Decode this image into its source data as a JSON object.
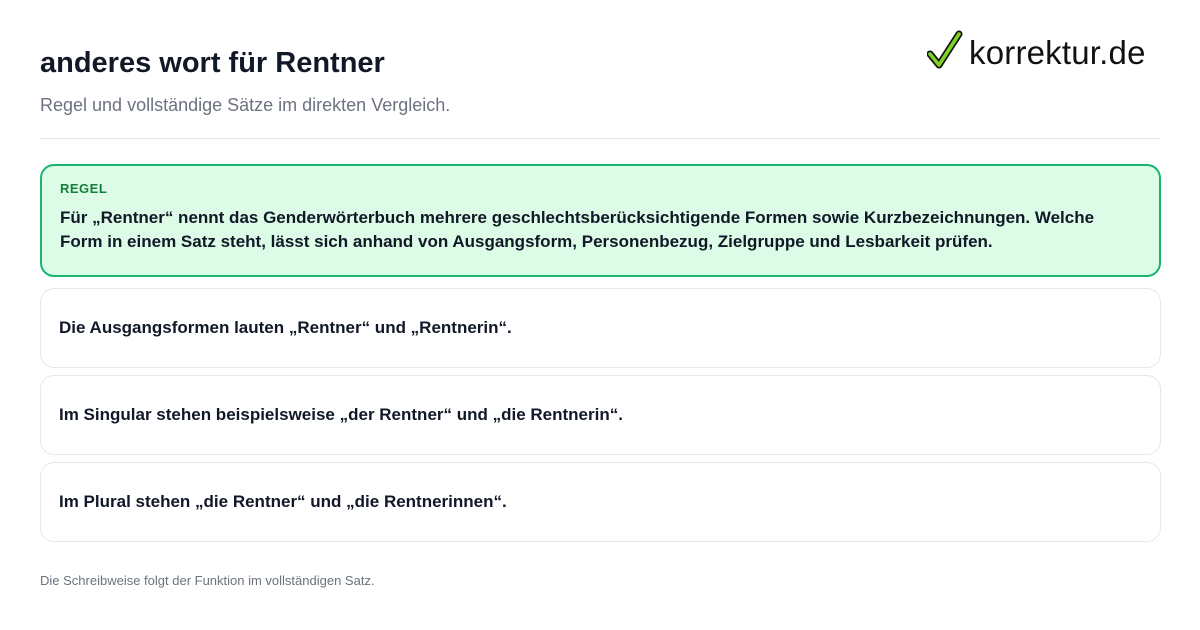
{
  "header": {
    "title": "anderes wort für Rentner",
    "subtitle": "Regel und vollständige Sätze im direkten Vergleich."
  },
  "logo": {
    "text": "korrektur.de",
    "icon": "checkmark-icon"
  },
  "rule": {
    "label": "REGEL",
    "text": "Für „Rentner“ nennt das Genderwörterbuch mehrere geschlechtsberücksichtigende Formen sowie Kurzbezeichnungen. Welche Form in einem Satz steht, lässt sich anhand von Ausgangsform, Personenbezug, Zielgruppe und Lesbarkeit prüfen."
  },
  "examples": [
    {
      "text": "Die Ausgangsformen lauten „Rentner“ und „Rentnerin“."
    },
    {
      "text": "Im Singular stehen beispielsweise „der Rentner“ und „die Rentnerin“."
    },
    {
      "text": "Im Plural stehen „die Rentner“ und „die Rentnerinnen“."
    }
  ],
  "footer": {
    "text": "Die Schreibweise folgt der Funktion im vollständigen Satz."
  },
  "colors": {
    "rule_border": "#19b46e",
    "rule_background": "#dcfce7",
    "rule_label": "#15803d",
    "check_green": "#7ed321"
  }
}
